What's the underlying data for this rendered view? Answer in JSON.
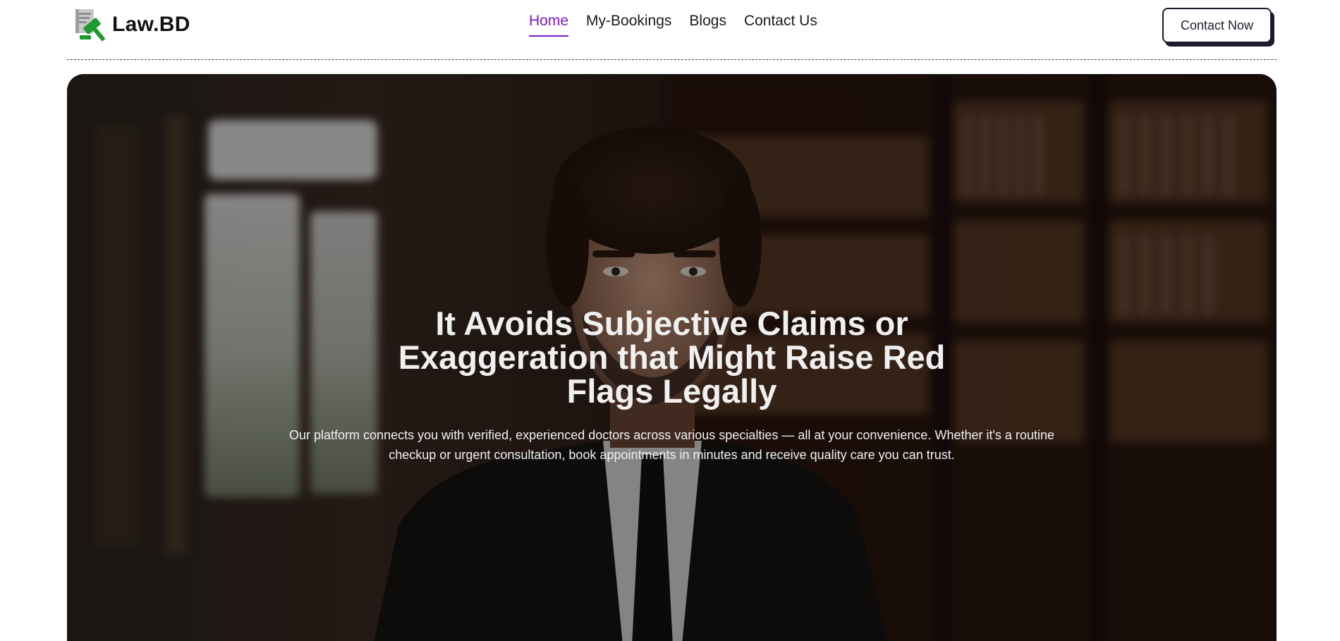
{
  "brand": {
    "name": "Law.BD",
    "logo_icon": "law-gavel-document-icon",
    "colors": {
      "accent": "#7b16c9",
      "logo_green": "#1e9b2e",
      "button_border": "#1b1b2e"
    }
  },
  "nav": {
    "items": [
      {
        "label": "Home",
        "active": true
      },
      {
        "label": "My-Bookings",
        "active": false
      },
      {
        "label": "Blogs",
        "active": false
      },
      {
        "label": "Contact Us",
        "active": false
      }
    ],
    "cta_label": "Contact Now"
  },
  "hero": {
    "title": "It Avoids Subjective Claims or Exaggeration that Might Raise Red Flags Legally",
    "description": "Our platform connects you with verified, experienced doctors across various specialties — all at your convenience. Whether it's a routine checkup or urgent consultation, book appointments in minutes and receive quality care you can trust."
  }
}
